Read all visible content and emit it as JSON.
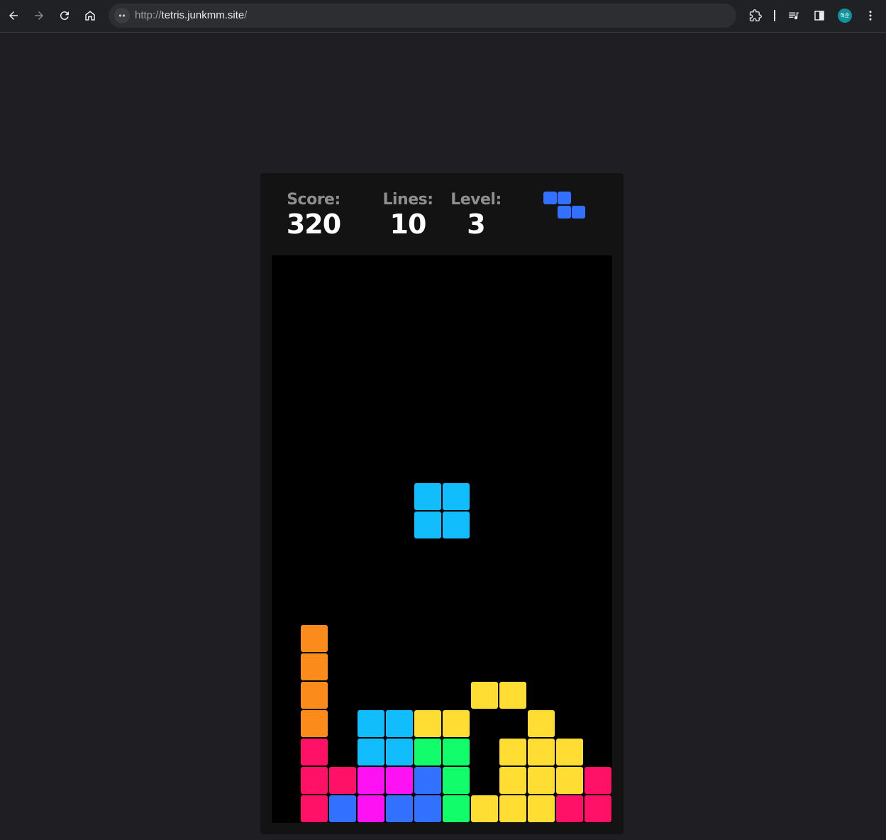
{
  "browser": {
    "url_scheme": "http://",
    "url_host": "tetris.junkmm.site",
    "url_path": "/",
    "profile_initials": "혁준"
  },
  "game": {
    "score_label": "Score:",
    "score_value": "320",
    "lines_label": "Lines:",
    "lines_value": "10",
    "level_label": "Level:",
    "level_value": "3",
    "colors": {
      "O": "#11bdfd",
      "I": "#fb8b1a",
      "T": "#fe11f2",
      "J": "#3270ff",
      "S": "#11fd69",
      "Z": "#fe1167",
      "L": "#ffdd33"
    },
    "next_piece": {
      "type": "Z",
      "cells": [
        [
          0,
          0
        ],
        [
          1,
          0
        ],
        [
          1,
          1
        ],
        [
          2,
          1
        ]
      ]
    },
    "active_piece": {
      "type": "O",
      "cells": [
        [
          5,
          8
        ],
        [
          6,
          8
        ],
        [
          5,
          9
        ],
        [
          6,
          9
        ]
      ]
    },
    "board_cols": 12,
    "board_rows": 20,
    "board_rows_visible_bottom": [
      "-I----------",
      "-I----------",
      "-I-----LL---",
      "-I-OOLL--L--",
      "-Z-OOSS-LLL-",
      "-ZZTTJS-LLLZ",
      "-ZJTJJSLLLZZ"
    ]
  }
}
